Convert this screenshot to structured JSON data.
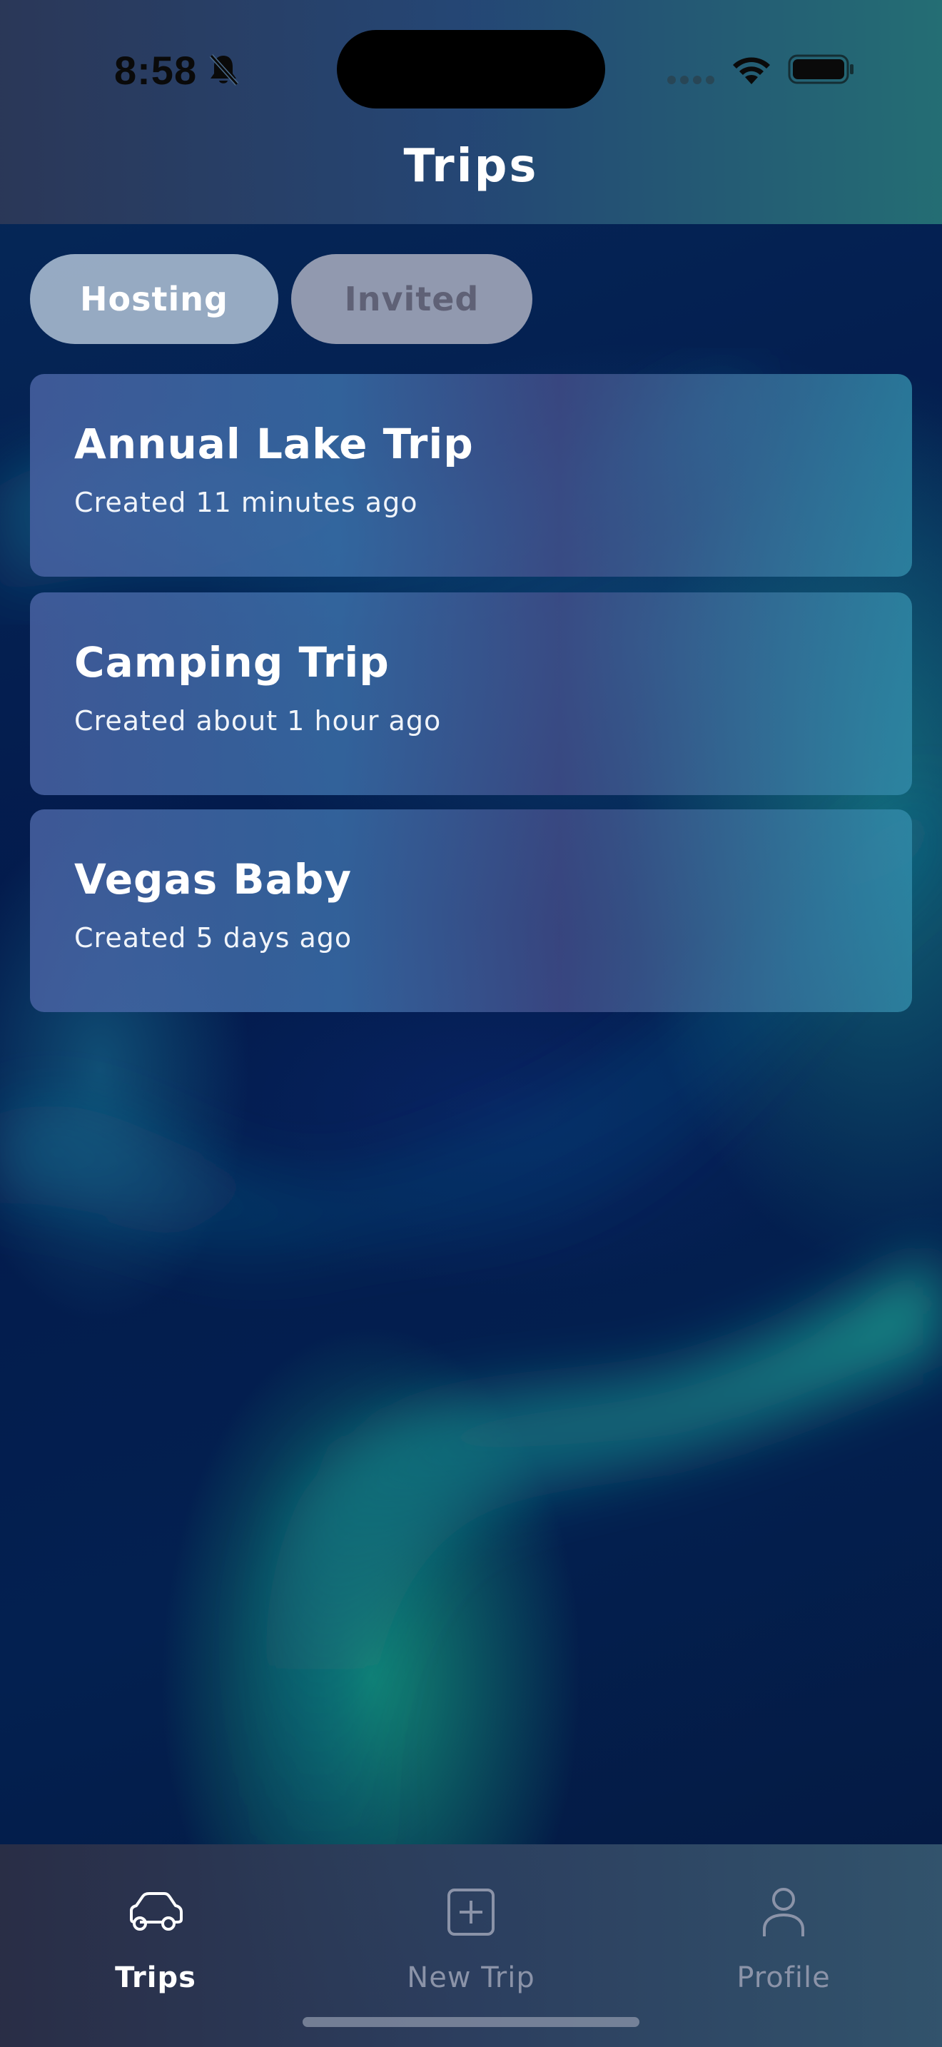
{
  "status_bar": {
    "time": "8:58"
  },
  "header": {
    "title": "Trips"
  },
  "segments": [
    {
      "label": "Hosting",
      "selected": true
    },
    {
      "label": "Invited",
      "selected": false
    }
  ],
  "trips": [
    {
      "name": "Annual Lake Trip",
      "created": "Created 11 minutes ago"
    },
    {
      "name": "Camping Trip",
      "created": "Created about 1 hour ago"
    },
    {
      "name": "Vegas Baby",
      "created": "Created 5 days ago"
    }
  ],
  "tab_bar": {
    "items": [
      {
        "label": "Trips",
        "icon": "car-icon",
        "active": true
      },
      {
        "label": "New Trip",
        "icon": "plus-square-icon",
        "active": false
      },
      {
        "label": "Profile",
        "icon": "person-icon",
        "active": false
      }
    ]
  },
  "colors": {
    "background": "#031645",
    "accent_teal": "#1fa096",
    "tab_active": "#ffffff",
    "tab_inactive": "#8b93a8"
  }
}
